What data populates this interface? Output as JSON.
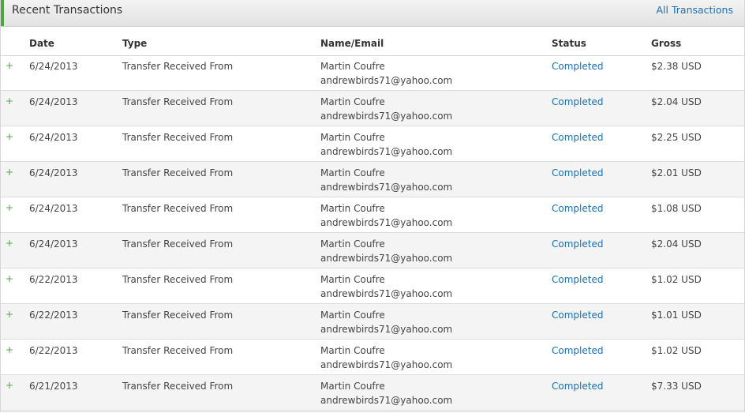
{
  "header": {
    "title": "Recent Transactions",
    "all_link": "All Transactions",
    "accent_color": "#4ea640",
    "link_color": "#1a6fb5"
  },
  "columns": {
    "date": "Date",
    "type": "Type",
    "name": "Name/Email",
    "status": "Status",
    "gross": "Gross"
  },
  "rows": [
    {
      "expand": "+",
      "date": "6/24/2013",
      "type": "Transfer Received From",
      "name": "Martin Coufre",
      "email": "andrewbirds71@yahoo.com",
      "status": "Completed",
      "gross": "$2.38 USD"
    },
    {
      "expand": "+",
      "date": "6/24/2013",
      "type": "Transfer Received From",
      "name": "Martin Coufre",
      "email": "andrewbirds71@yahoo.com",
      "status": "Completed",
      "gross": "$2.04 USD"
    },
    {
      "expand": "+",
      "date": "6/24/2013",
      "type": "Transfer Received From",
      "name": "Martin Coufre",
      "email": "andrewbirds71@yahoo.com",
      "status": "Completed",
      "gross": "$2.25 USD"
    },
    {
      "expand": "+",
      "date": "6/24/2013",
      "type": "Transfer Received From",
      "name": "Martin Coufre",
      "email": "andrewbirds71@yahoo.com",
      "status": "Completed",
      "gross": "$2.01 USD"
    },
    {
      "expand": "+",
      "date": "6/24/2013",
      "type": "Transfer Received From",
      "name": "Martin Coufre",
      "email": "andrewbirds71@yahoo.com",
      "status": "Completed",
      "gross": "$1.08 USD"
    },
    {
      "expand": "+",
      "date": "6/24/2013",
      "type": "Transfer Received From",
      "name": "Martin Coufre",
      "email": "andrewbirds71@yahoo.com",
      "status": "Completed",
      "gross": "$2.04 USD"
    },
    {
      "expand": "+",
      "date": "6/22/2013",
      "type": "Transfer Received From",
      "name": "Martin Coufre",
      "email": "andrewbirds71@yahoo.com",
      "status": "Completed",
      "gross": "$1.02 USD"
    },
    {
      "expand": "+",
      "date": "6/22/2013",
      "type": "Transfer Received From",
      "name": "Martin Coufre",
      "email": "andrewbirds71@yahoo.com",
      "status": "Completed",
      "gross": "$1.01 USD"
    },
    {
      "expand": "+",
      "date": "6/22/2013",
      "type": "Transfer Received From",
      "name": "Martin Coufre",
      "email": "andrewbirds71@yahoo.com",
      "status": "Completed",
      "gross": "$1.02 USD"
    },
    {
      "expand": "+",
      "date": "6/21/2013",
      "type": "Transfer Received From",
      "name": "Martin Coufre",
      "email": "andrewbirds71@yahoo.com",
      "status": "Completed",
      "gross": "$7.33 USD"
    }
  ]
}
